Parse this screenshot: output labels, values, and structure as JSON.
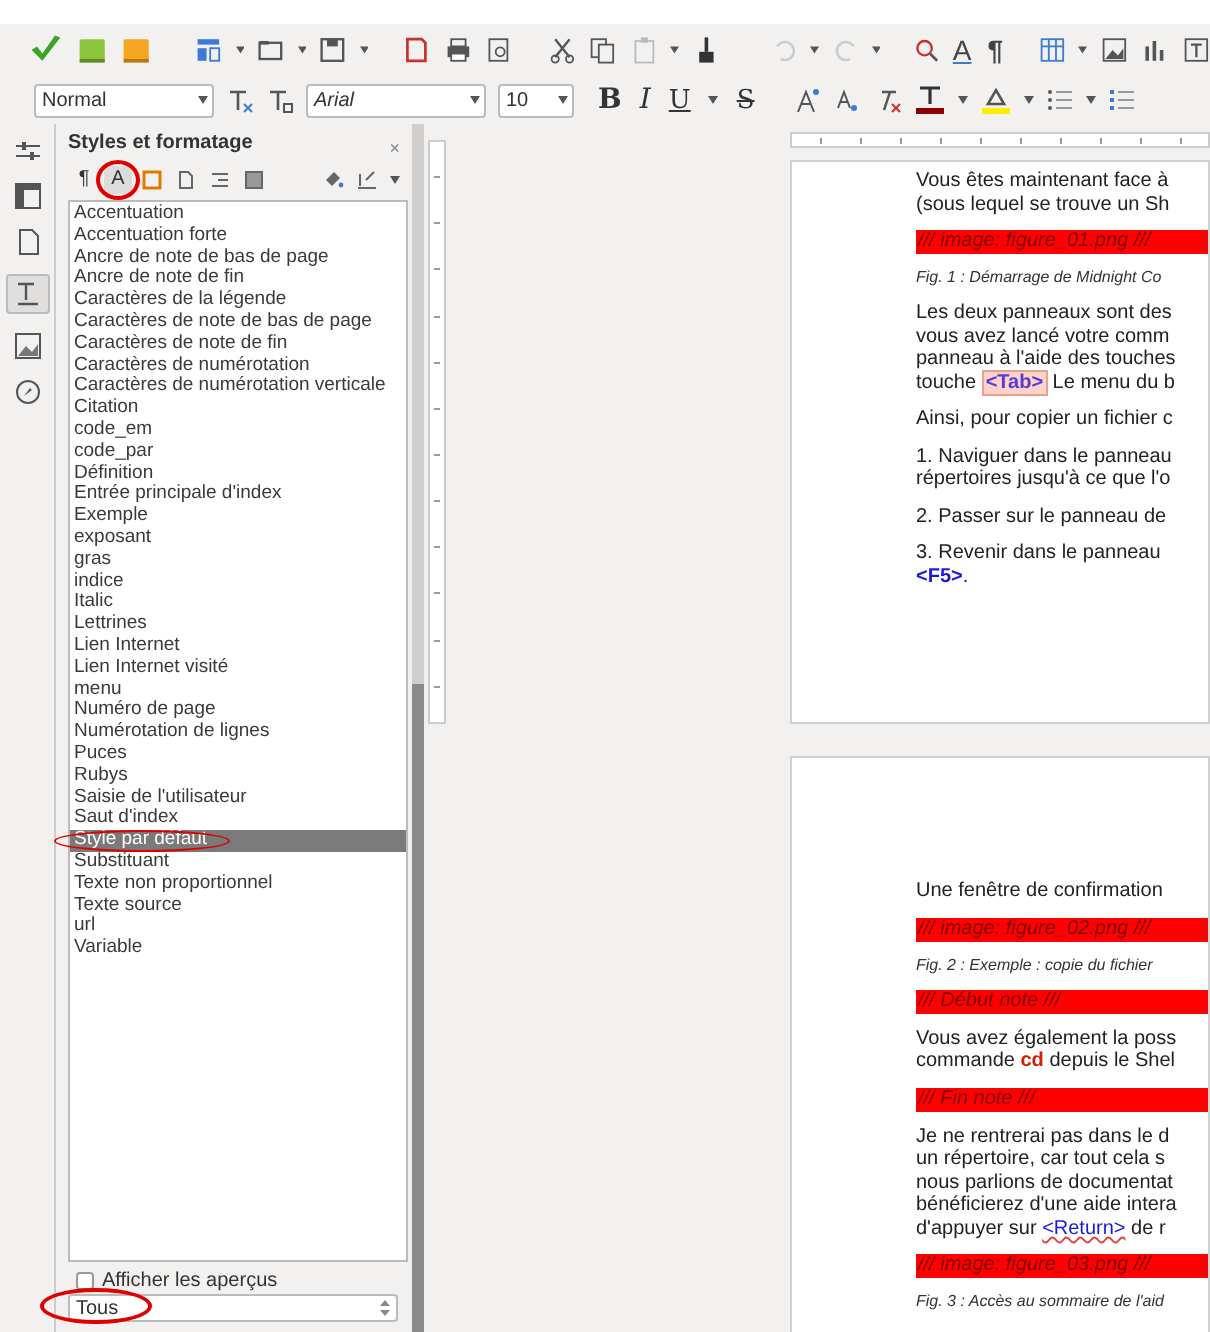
{
  "toolbar": {
    "style_box": "Normal",
    "font_box": "Arial",
    "size_box": "10",
    "glyph_buttons": [
      {
        "label": "A",
        "kind": "spelling"
      },
      {
        "label": "¶",
        "kind": "marks"
      }
    ],
    "format_buttons": [
      {
        "label": "B",
        "kind": "bold"
      },
      {
        "label": "I",
        "kind": "italic"
      },
      {
        "label": "U",
        "kind": "underline"
      },
      {
        "label": "S",
        "kind": "strike"
      }
    ]
  },
  "sidebar": {
    "title": "Styles et formatage",
    "close": "×",
    "families": [
      {
        "kind": "paragraph",
        "label": "¶",
        "selected": false,
        "circled": false
      },
      {
        "kind": "character",
        "label": "A",
        "selected": true,
        "circled": true
      },
      {
        "kind": "frame",
        "selected": false,
        "circled": false
      },
      {
        "kind": "page",
        "selected": false,
        "circled": false
      },
      {
        "kind": "list",
        "selected": false,
        "circled": false
      },
      {
        "kind": "table",
        "selected": false,
        "circled": false
      }
    ],
    "styles": [
      {
        "name": "Accentuation",
        "selected": false,
        "circled": false
      },
      {
        "name": "Accentuation forte",
        "selected": false,
        "circled": false
      },
      {
        "name": "Ancre de note de bas de page",
        "selected": false,
        "circled": false
      },
      {
        "name": "Ancre de note de fin",
        "selected": false,
        "circled": false
      },
      {
        "name": "Caractères de la légende",
        "selected": false,
        "circled": false
      },
      {
        "name": "Caractères de note de bas de page",
        "selected": false,
        "circled": false
      },
      {
        "name": "Caractères de note de fin",
        "selected": false,
        "circled": false
      },
      {
        "name": "Caractères de numérotation",
        "selected": false,
        "circled": false
      },
      {
        "name": "Caractères de numérotation verticale",
        "selected": false,
        "circled": false
      },
      {
        "name": "Citation",
        "selected": false,
        "circled": false
      },
      {
        "name": "code_em",
        "selected": false,
        "circled": false
      },
      {
        "name": "code_par",
        "selected": false,
        "circled": false
      },
      {
        "name": "Définition",
        "selected": false,
        "circled": false
      },
      {
        "name": "Entrée principale d'index",
        "selected": false,
        "circled": false
      },
      {
        "name": "Exemple",
        "selected": false,
        "circled": false
      },
      {
        "name": "exposant",
        "selected": false,
        "circled": false
      },
      {
        "name": "gras",
        "selected": false,
        "circled": false
      },
      {
        "name": "indice",
        "selected": false,
        "circled": false
      },
      {
        "name": "Italic",
        "selected": false,
        "circled": false
      },
      {
        "name": "Lettrines",
        "selected": false,
        "circled": false
      },
      {
        "name": "Lien Internet",
        "selected": false,
        "circled": false
      },
      {
        "name": "Lien Internet visité",
        "selected": false,
        "circled": false
      },
      {
        "name": "menu",
        "selected": false,
        "circled": false
      },
      {
        "name": "Numéro de page",
        "selected": false,
        "circled": false
      },
      {
        "name": "Numérotation de lignes",
        "selected": false,
        "circled": false
      },
      {
        "name": "Puces",
        "selected": false,
        "circled": false
      },
      {
        "name": "Rubys",
        "selected": false,
        "circled": false
      },
      {
        "name": "Saisie de l'utilisateur",
        "selected": false,
        "circled": false
      },
      {
        "name": "Saut d'index",
        "selected": false,
        "circled": false
      },
      {
        "name": "Style par défaut",
        "selected": true,
        "circled": true
      },
      {
        "name": "Substituant",
        "selected": false,
        "circled": false
      },
      {
        "name": "Texte non proportionnel",
        "selected": false,
        "circled": false
      },
      {
        "name": "Texte source",
        "selected": false,
        "circled": false
      },
      {
        "name": "url",
        "selected": false,
        "circled": false
      },
      {
        "name": "Variable",
        "selected": false,
        "circled": false
      }
    ],
    "show_previews": {
      "label": "Afficher les aperçus",
      "checked": false
    },
    "filter": {
      "value": "Tous",
      "circled": true
    }
  },
  "pages": [
    {
      "blocks": [
        {
          "kind": "para",
          "lines": [
            [
              {
                "text": "Vous êtes maintenant face à",
                "kind": "plain"
              }
            ],
            [
              {
                "text": "(sous lequel se trouve un Sh",
                "kind": "plain"
              }
            ]
          ]
        },
        {
          "kind": "bar",
          "text": "/// image: figure_01.png ///"
        },
        {
          "kind": "caption",
          "text": "Fig. 1 : Démarrage de Midnight Co"
        },
        {
          "kind": "para",
          "lines": [
            [
              {
                "text": "Les deux panneaux sont des",
                "kind": "plain"
              }
            ],
            [
              {
                "text": "vous avez lancé votre comm",
                "kind": "plain"
              }
            ],
            [
              {
                "text": "panneau à l'aide des touches",
                "kind": "plain"
              }
            ],
            [
              {
                "text": "touche ",
                "kind": "plain"
              },
              {
                "text": "<Tab>",
                "kind": "key-boxed"
              },
              {
                "text": " Le menu du b",
                "kind": "plain"
              }
            ]
          ]
        },
        {
          "kind": "para",
          "lines": [
            [
              {
                "text": "Ainsi, pour copier un fichier c",
                "kind": "plain"
              }
            ]
          ]
        },
        {
          "kind": "para",
          "lines": [
            [
              {
                "text": "1. Naviguer dans le panneau",
                "kind": "plain"
              }
            ],
            [
              {
                "text": "répertoires jusqu'à ce que l'o",
                "kind": "plain"
              }
            ]
          ]
        },
        {
          "kind": "para",
          "lines": [
            [
              {
                "text": "2. Passer sur le panneau de",
                "kind": "plain"
              }
            ]
          ]
        },
        {
          "kind": "para",
          "lines": [
            [
              {
                "text": "3. Revenir dans le panneau",
                "kind": "plain"
              }
            ],
            [
              {
                "text": "<F5>",
                "kind": "key"
              },
              {
                "text": ".",
                "kind": "plain"
              }
            ]
          ]
        }
      ]
    },
    {
      "blocks": [
        {
          "kind": "para",
          "lines": [
            [
              {
                "text": "Une fenêtre de confirmation",
                "kind": "plain"
              }
            ]
          ]
        },
        {
          "kind": "bar",
          "text": "/// image: figure_02.png ///"
        },
        {
          "kind": "caption",
          "text": "Fig. 2 : Exemple : copie du fichier"
        },
        {
          "kind": "bar",
          "text": "/// Début note ///"
        },
        {
          "kind": "para",
          "lines": [
            [
              {
                "text": "Vous avez également la poss",
                "kind": "plain"
              }
            ],
            [
              {
                "text": "commande ",
                "kind": "plain"
              },
              {
                "text": "cd",
                "kind": "cmd"
              },
              {
                "text": " depuis le Shel",
                "kind": "plain"
              }
            ]
          ]
        },
        {
          "kind": "bar",
          "text": "/// Fin note ///"
        },
        {
          "kind": "para",
          "lines": [
            [
              {
                "text": "Je ne rentrerai pas dans le d",
                "kind": "plain"
              }
            ],
            [
              {
                "text": "un répertoire, car tout cela s",
                "kind": "plain"
              }
            ],
            [
              {
                "text": "nous parlions de documentat",
                "kind": "plain"
              }
            ],
            [
              {
                "text": "bénéficierez d'une aide intera",
                "kind": "plain"
              }
            ],
            [
              {
                "text": "d'appuyer sur ",
                "kind": "plain"
              },
              {
                "text": "<Return>",
                "kind": "link"
              },
              {
                "text": " de r",
                "kind": "plain"
              }
            ]
          ]
        },
        {
          "kind": "bar",
          "text": "/// image: figure_03.png ///"
        },
        {
          "kind": "caption",
          "text": "Fig. 3 : Accès au sommaire de l'aid"
        }
      ]
    }
  ]
}
